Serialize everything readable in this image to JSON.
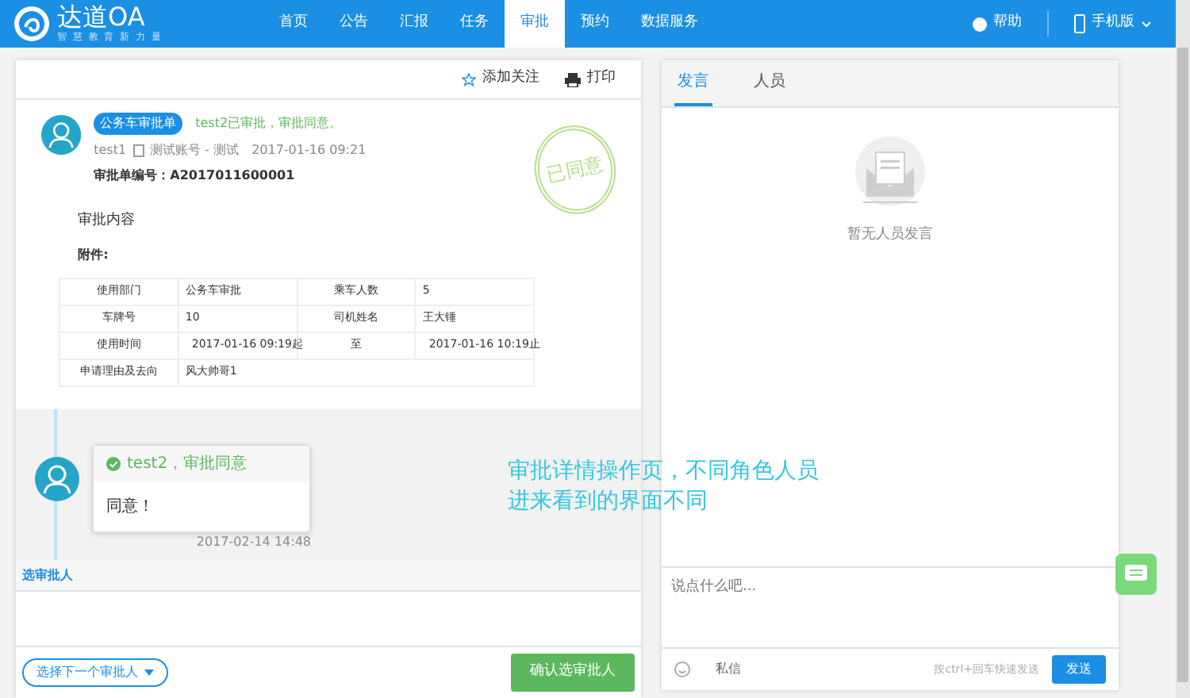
{
  "brand": {
    "name": "达道OA",
    "slogan": "智 慧 教 育 新 力 量"
  },
  "nav": [
    {
      "label": "首页",
      "selected": false
    },
    {
      "label": "公告",
      "selected": false
    },
    {
      "label": "汇报",
      "selected": false
    },
    {
      "label": "任务",
      "selected": false
    },
    {
      "label": "审批",
      "selected": true
    },
    {
      "label": "预约",
      "selected": false
    },
    {
      "label": "数据服务",
      "selected": false
    }
  ],
  "nav_right": {
    "help": "帮助",
    "mobile": "手机版"
  },
  "toolbar": {
    "follow": "添加关注",
    "print": "打印"
  },
  "approval": {
    "tag": "公务车审批单",
    "status": "test2已审批，审批同意。",
    "user": "test1",
    "account": "测试账号 - 测试",
    "time": "2017-01-16 09:21",
    "number_label": "审批单编号：",
    "number": "A2017011600001",
    "content": "审批内容",
    "attachments": "附件:",
    "stamp": "已同意",
    "table": [
      [
        "使用部门",
        "公务车审批",
        "乘车人数",
        "5"
      ],
      [
        "车牌号",
        "10",
        "司机姓名",
        "王大锤"
      ],
      [
        "使用时间",
        "2017-01-16 09:19",
        "起",
        "至",
        "2017-01-16 10:19",
        "止"
      ],
      [
        "申请理由及去向",
        "风大帅哥1"
      ]
    ]
  },
  "timeline": [
    {
      "title": "test2，审批同意",
      "body": "同意！",
      "time": "2017-02-14 14:48"
    }
  ],
  "annotation": [
    "审批详情操作页，不同角色人员",
    "进来看到的界面不同"
  ],
  "choose": {
    "title": "选审批人",
    "select": "选择下一个审批人",
    "confirm": "确认选审批人"
  },
  "side_tabs": [
    {
      "label": "发言",
      "selected": true
    },
    {
      "label": "人员",
      "selected": false
    }
  ],
  "empty_text": "暂无人员发言",
  "comment": {
    "placeholder": "说点什么吧...",
    "private": "私信",
    "hint": "按ctrl+回车快速发送",
    "send": "发送"
  }
}
